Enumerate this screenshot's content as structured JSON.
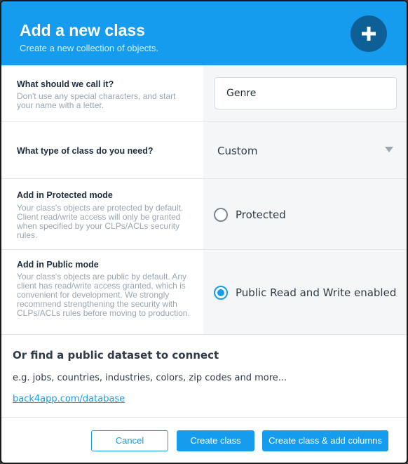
{
  "header": {
    "title": "Add a new class",
    "subtitle": "Create a new collection of objects.",
    "icon": "plus-icon"
  },
  "fields": {
    "name": {
      "label": "What should we call it?",
      "description": "Don't use any special characters, and start your name with a letter.",
      "value": "Genre"
    },
    "type": {
      "label": "What type of class do you need?",
      "selected": "Custom",
      "icon": "chevron-down-icon"
    },
    "protected": {
      "label": "Add in Protected mode",
      "description": "Your class's objects are protected by default. Client read/write access will only be granted when specified by your CLPs/ACLs security rules.",
      "option_label": "Protected",
      "selected": false
    },
    "public": {
      "label": "Add in Public mode",
      "description": "Your class's objects are public by default. Any client has read/write access granted, which is convenient for development. We strongly recommend strengthening the security with CLPs/ACLs rules before moving to production.",
      "option_label": "Public Read and Write enabled",
      "selected": true
    }
  },
  "dataset": {
    "heading": "Or find a public dataset to connect",
    "example": "e.g. jobs, countries, industries, colors, zip codes and more...",
    "link": "back4app.com/database"
  },
  "footer": {
    "cancel_label": "Cancel",
    "create_label": "Create class",
    "create_columns_label": "Create class & add columns"
  },
  "colors": {
    "accent": "#169cee",
    "header_icon_bg": "#0d5f95"
  }
}
